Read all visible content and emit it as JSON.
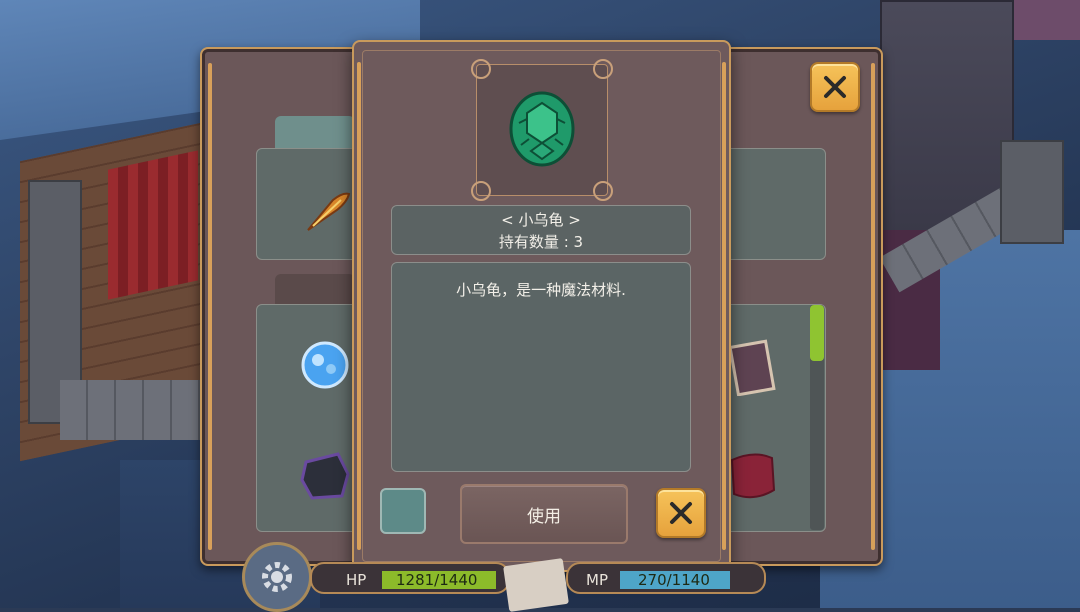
{
  "item": {
    "name_title": "< 小乌龟 >",
    "quantity_label": "持有数量 : 3",
    "description": "小乌龟，是一种魔法材料.",
    "icon": "green-turtle-shell-icon"
  },
  "actions": {
    "use_label": "使用"
  },
  "hud": {
    "hp_label": "HP",
    "hp_value": "1281/1440",
    "mp_label": "MP",
    "mp_value": "270/1140",
    "hp_fraction": 0.89,
    "mp_fraction": 0.24
  },
  "colors": {
    "accent_gold": "#d8a05a",
    "close_button": "#f0b44c",
    "hp_bar": "#8cbb2a",
    "mp_bar": "#4ea5c8",
    "scroll_thumb": "#8fc431"
  },
  "icons": [
    "close-icon",
    "gear-icon",
    "feather-quill-icon",
    "blue-crystal-icon",
    "dark-ore-icon",
    "book-icon",
    "red-cloth-icon"
  ]
}
